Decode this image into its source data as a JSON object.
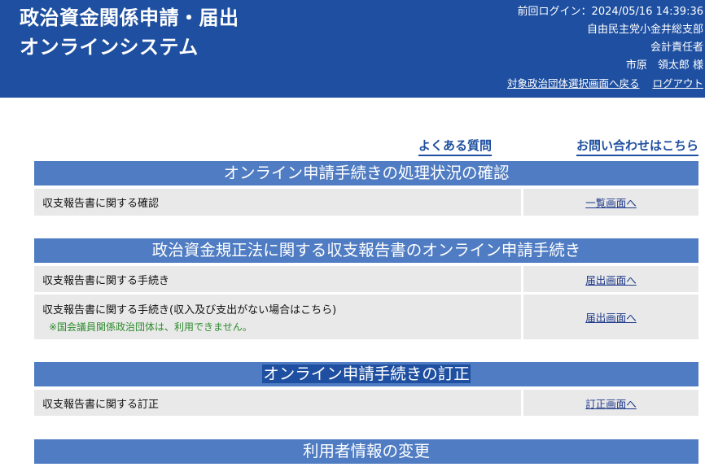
{
  "header": {
    "title_line1": "政治資金関係申請・届出",
    "title_line2": "オンラインシステム",
    "last_login": "前回ログイン：2024/05/16 14:39:36",
    "org": "自由民主党小金井総支部",
    "role": "会計責任者",
    "user": "市原　領太郎 様",
    "links": {
      "back": "対象政治団体選択画面へ戻る",
      "logout": "ログアウト"
    }
  },
  "help": {
    "faq": "よくある質問",
    "contact": "お問い合わせはこちら"
  },
  "sections": [
    {
      "title": "オンライン申請手続きの処理状況の確認",
      "rows": [
        {
          "label": "収支報告書に関する確認",
          "link": "一覧画面へ"
        }
      ]
    },
    {
      "title": "政治資金規正法に関する収支報告書のオンライン申請手続き",
      "rows": [
        {
          "label": "収支報告書に関する手続き",
          "link": "届出画面へ"
        },
        {
          "label": "収支報告書に関する手続き(収入及び支出がない場合はこちら)",
          "note": "※国会議員関係政治団体は、利用できません。",
          "link": "届出画面へ"
        }
      ]
    },
    {
      "title": "オンライン申請手続きの訂正",
      "rows": [
        {
          "label": "収支報告書に関する訂正",
          "link": "訂正画面へ"
        }
      ]
    },
    {
      "title": "利用者情報の変更"
    }
  ]
}
